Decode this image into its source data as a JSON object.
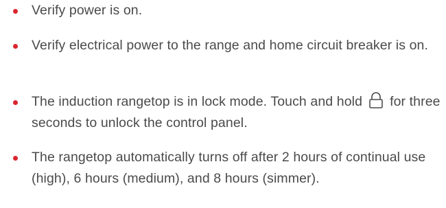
{
  "bullets": {
    "item1": "Verify power is on.",
    "item2": "Verify electrical power to the range and home circuit breaker is on.",
    "item3_before": "The induction rangetop is in lock mode. Touch and hold",
    "item3_after": "for three seconds to unlock the control panel.",
    "item3_icon": "lock-icon",
    "item4": "The rangetop automatically turns off after 2 hours of continual use (high), 6 hours (medium), and 8 hours (simmer)."
  },
  "colors": {
    "bullet": "#d9262e",
    "text": "#4a4a4a"
  }
}
